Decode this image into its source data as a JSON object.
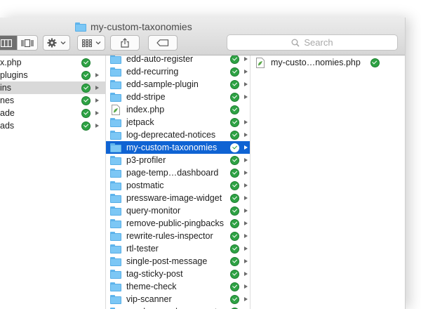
{
  "window": {
    "title": "my-custom-taxonomies"
  },
  "toolbar": {
    "search_placeholder": "Search",
    "icons": [
      "column-view-icon",
      "cover-flow-icon",
      "gear-icon",
      "arrange-grid-icon",
      "share-icon",
      "tag-icon",
      "search-icon"
    ]
  },
  "column1": {
    "items": [
      {
        "label": "x.php",
        "checked": true,
        "arrow": false,
        "highlight": false
      },
      {
        "label": "plugins",
        "checked": true,
        "arrow": true,
        "highlight": false
      },
      {
        "label": "ins",
        "checked": true,
        "arrow": true,
        "highlight": true
      },
      {
        "label": "nes",
        "checked": true,
        "arrow": true,
        "highlight": false
      },
      {
        "label": "ade",
        "checked": true,
        "arrow": true,
        "highlight": false
      },
      {
        "label": "ads",
        "checked": true,
        "arrow": true,
        "highlight": false
      }
    ]
  },
  "column2": {
    "items": [
      {
        "label": "edd-auto-register",
        "type": "folder",
        "selected": false
      },
      {
        "label": "edd-recurring",
        "type": "folder",
        "selected": false
      },
      {
        "label": "edd-sample-plugin",
        "type": "folder",
        "selected": false
      },
      {
        "label": "edd-stripe",
        "type": "folder",
        "selected": false
      },
      {
        "label": "index.php",
        "type": "file",
        "selected": false
      },
      {
        "label": "jetpack",
        "type": "folder",
        "selected": false
      },
      {
        "label": "log-deprecated-notices",
        "type": "folder",
        "selected": false
      },
      {
        "label": "my-custom-taxonomies",
        "type": "folder",
        "selected": true
      },
      {
        "label": "p3-profiler",
        "type": "folder",
        "selected": false
      },
      {
        "label": "page-temp…dashboard",
        "type": "folder",
        "selected": false
      },
      {
        "label": "postmatic",
        "type": "folder",
        "selected": false
      },
      {
        "label": "pressware-image-widget",
        "type": "folder",
        "selected": false
      },
      {
        "label": "query-monitor",
        "type": "folder",
        "selected": false
      },
      {
        "label": "remove-public-pingbacks",
        "type": "folder",
        "selected": false
      },
      {
        "label": "rewrite-rules-inspector",
        "type": "folder",
        "selected": false
      },
      {
        "label": "rtl-tester",
        "type": "folder",
        "selected": false
      },
      {
        "label": "single-post-message",
        "type": "folder",
        "selected": false
      },
      {
        "label": "tag-sticky-post",
        "type": "folder",
        "selected": false
      },
      {
        "label": "theme-check",
        "type": "folder",
        "selected": false
      },
      {
        "label": "vip-scanner",
        "type": "folder",
        "selected": false
      },
      {
        "label": "wordpress…base-reset",
        "type": "folder",
        "selected": false
      }
    ]
  },
  "column3": {
    "items": [
      {
        "label": "my-custo…nomies.php",
        "type": "file",
        "checked": true
      }
    ]
  },
  "colors": {
    "selection": "#0f63d3",
    "sync_green": "#2ea244",
    "folder": "#7cc7f5"
  }
}
